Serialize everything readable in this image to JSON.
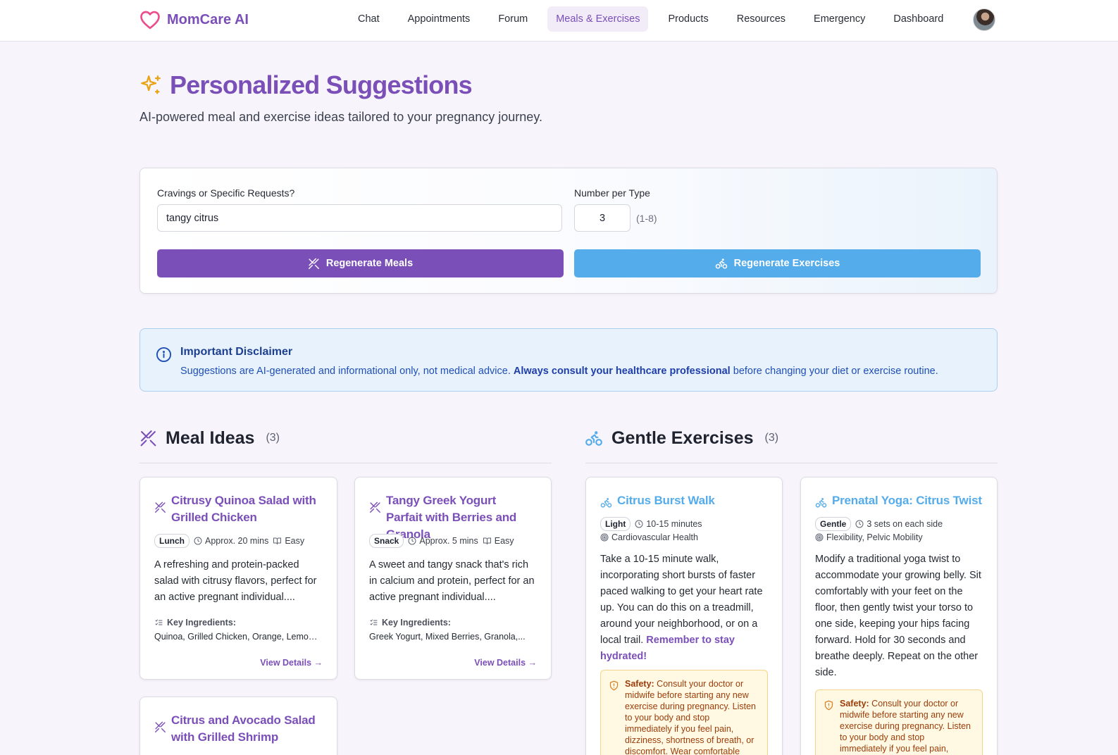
{
  "app": {
    "name": "MomCare AI"
  },
  "nav": {
    "items": [
      {
        "label": "Chat"
      },
      {
        "label": "Appointments"
      },
      {
        "label": "Forum"
      },
      {
        "label": "Meals & Exercises",
        "active": true
      },
      {
        "label": "Products"
      },
      {
        "label": "Resources"
      },
      {
        "label": "Emergency"
      },
      {
        "label": "Dashboard"
      }
    ]
  },
  "page": {
    "title": "Personalized Suggestions",
    "subtitle": "AI-powered meal and exercise ideas tailored to your pregnancy journey."
  },
  "form": {
    "cravings_label": "Cravings or Specific Requests?",
    "cravings_value": "tangy citrus",
    "number_label": "Number per Type",
    "number_value": "3",
    "number_range": "(1-8)",
    "regen_meals": "Regenerate Meals",
    "regen_exercises": "Regenerate Exercises"
  },
  "disclaimer": {
    "title": "Important Disclaimer",
    "text_start": "Suggestions are AI-generated and informational only, not medical advice.",
    "text_bold": "Always consult your healthcare professional",
    "text_end": "before changing your diet or exercise routine."
  },
  "meals": {
    "heading": "Meal Ideas",
    "count": "(3)",
    "ingredients_label": "Key Ingredients:",
    "details_link": "View Details →",
    "items": [
      {
        "title": "Citrusy Quinoa Salad with Grilled Chicken",
        "type": "Lunch",
        "time": "Approx. 20 mins",
        "difficulty": "Easy",
        "description": "A refreshing and protein-packed salad with citrusy flavors, perfect for an active pregnant individual....",
        "ingredients": "Quinoa, Grilled Chicken, Orange, Lemon..."
      },
      {
        "title": "Tangy Greek Yogurt Parfait with Berries and Granola",
        "type": "Snack",
        "time": "Approx. 5 mins",
        "difficulty": "Easy",
        "description": "A sweet and tangy snack that's rich in calcium and protein, perfect for an active pregnant individual....",
        "ingredients": "Greek Yogurt, Mixed Berries, Granola,..."
      },
      {
        "title": "Citrus and Avocado Salad with Grilled Shrimp"
      }
    ]
  },
  "exercises": {
    "heading": "Gentle Exercises",
    "count": "(3)",
    "safety_label": "Safety:",
    "items": [
      {
        "title": "Citrus Burst Walk",
        "intensity": "Light",
        "duration": "10-15 minutes",
        "focus": "Cardiovascular Health",
        "description": "Take a 10-15 minute walk, incorporating short bursts of faster paced walking to get your heart rate up. You can do this on a treadmill, around your neighborhood, or on a local trail.",
        "description_highlight": "Remember to stay hydrated!",
        "safety": "Consult your doctor or midwife before starting any new exercise during pregnancy. Listen to your body and stop immediately if you feel pain, dizziness, shortness of breath, or discomfort. Wear comfortable"
      },
      {
        "title": "Prenatal Yoga: Citrus Twist",
        "intensity": "Gentle",
        "duration": "3 sets on each side",
        "focus": "Flexibility, Pelvic Mobility",
        "description": "Modify a traditional yoga twist to accommodate your growing belly. Sit comfortably with your feet on the floor, then gently twist your torso to one side, keeping your hips facing forward. Hold for 30 seconds and breathe deeply. Repeat on the other side.",
        "safety": "Consult your doctor or midwife before starting any new exercise during pregnancy. Listen to your body and stop immediately if you feel pain,"
      }
    ]
  },
  "colors": {
    "brand": "#7b4fb8",
    "exercise_accent": "#55acea",
    "disclaimer_bg": "#e8f2fc",
    "safety_bg": "#fff8e3"
  }
}
